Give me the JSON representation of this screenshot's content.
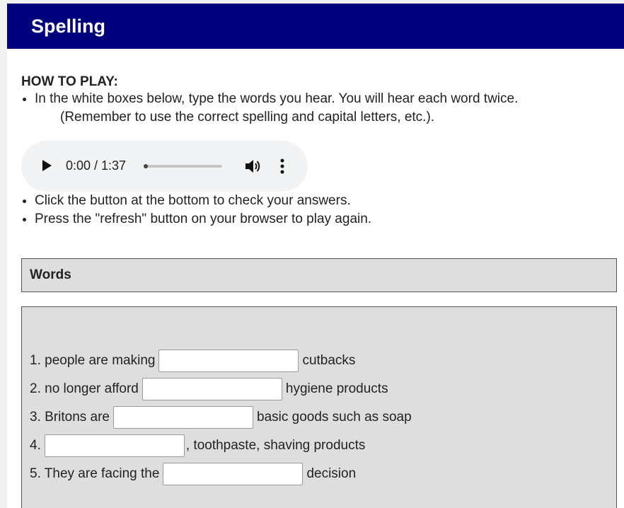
{
  "header": {
    "title": "Spelling"
  },
  "instructions": {
    "heading": "HOW TO PLAY:",
    "bullet1_line1": "In the white boxes below, type the words you hear. You will hear each word twice.",
    "bullet1_line2": "(Remember to use the correct spelling and capital letters, etc.).",
    "bullet2": "Click the button at the bottom to check your answers.",
    "bullet3": "Press the \"refresh\" button on your browser to play again."
  },
  "audio": {
    "time": "0:00 / 1:37",
    "progress": 0,
    "icons": {
      "play": "play-icon",
      "volume": "volume-icon",
      "menu": "more-options-icon"
    }
  },
  "words_section": {
    "title": "Words"
  },
  "questions": [
    {
      "before": "1. people are making",
      "after": "cutbacks",
      "value": ""
    },
    {
      "before": "2. no longer afford",
      "after": "hygiene products",
      "value": ""
    },
    {
      "before": "3. Britons are",
      "after": "basic goods such as soap",
      "value": ""
    },
    {
      "before": "4.",
      "after": ", toothpaste, shaving products",
      "value": ""
    },
    {
      "before": "5. They are facing the",
      "after": "decision",
      "value": ""
    }
  ],
  "colors": {
    "header_bg": "#00007f",
    "box_bg": "#dedede",
    "audio_bg": "#f1f3f4"
  }
}
